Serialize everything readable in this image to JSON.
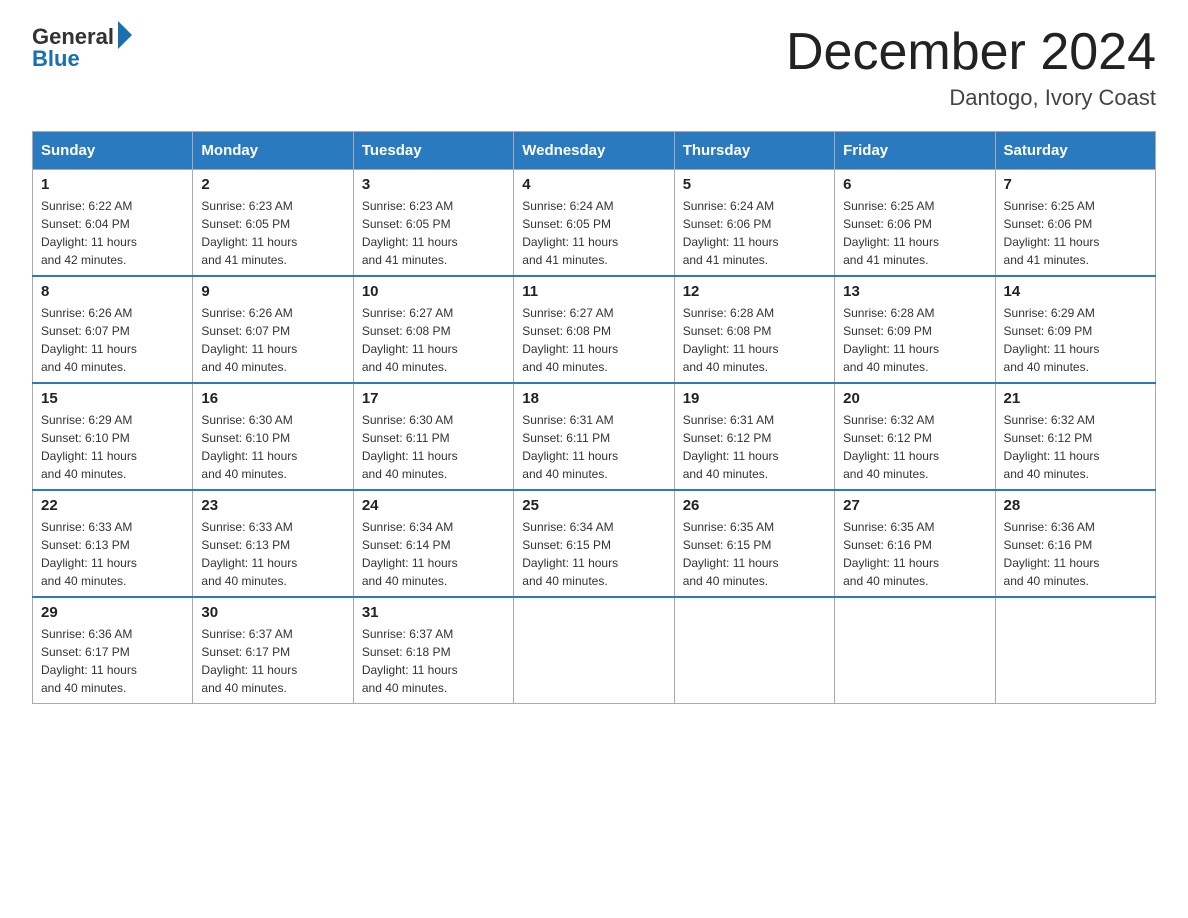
{
  "header": {
    "logo_general": "General",
    "logo_blue": "Blue",
    "title": "December 2024",
    "subtitle": "Dantogo, Ivory Coast"
  },
  "days_of_week": [
    "Sunday",
    "Monday",
    "Tuesday",
    "Wednesday",
    "Thursday",
    "Friday",
    "Saturday"
  ],
  "weeks": [
    [
      {
        "day": "1",
        "sunrise": "6:22 AM",
        "sunset": "6:04 PM",
        "daylight": "11 hours and 42 minutes."
      },
      {
        "day": "2",
        "sunrise": "6:23 AM",
        "sunset": "6:05 PM",
        "daylight": "11 hours and 41 minutes."
      },
      {
        "day": "3",
        "sunrise": "6:23 AM",
        "sunset": "6:05 PM",
        "daylight": "11 hours and 41 minutes."
      },
      {
        "day": "4",
        "sunrise": "6:24 AM",
        "sunset": "6:05 PM",
        "daylight": "11 hours and 41 minutes."
      },
      {
        "day": "5",
        "sunrise": "6:24 AM",
        "sunset": "6:06 PM",
        "daylight": "11 hours and 41 minutes."
      },
      {
        "day": "6",
        "sunrise": "6:25 AM",
        "sunset": "6:06 PM",
        "daylight": "11 hours and 41 minutes."
      },
      {
        "day": "7",
        "sunrise": "6:25 AM",
        "sunset": "6:06 PM",
        "daylight": "11 hours and 41 minutes."
      }
    ],
    [
      {
        "day": "8",
        "sunrise": "6:26 AM",
        "sunset": "6:07 PM",
        "daylight": "11 hours and 40 minutes."
      },
      {
        "day": "9",
        "sunrise": "6:26 AM",
        "sunset": "6:07 PM",
        "daylight": "11 hours and 40 minutes."
      },
      {
        "day": "10",
        "sunrise": "6:27 AM",
        "sunset": "6:08 PM",
        "daylight": "11 hours and 40 minutes."
      },
      {
        "day": "11",
        "sunrise": "6:27 AM",
        "sunset": "6:08 PM",
        "daylight": "11 hours and 40 minutes."
      },
      {
        "day": "12",
        "sunrise": "6:28 AM",
        "sunset": "6:08 PM",
        "daylight": "11 hours and 40 minutes."
      },
      {
        "day": "13",
        "sunrise": "6:28 AM",
        "sunset": "6:09 PM",
        "daylight": "11 hours and 40 minutes."
      },
      {
        "day": "14",
        "sunrise": "6:29 AM",
        "sunset": "6:09 PM",
        "daylight": "11 hours and 40 minutes."
      }
    ],
    [
      {
        "day": "15",
        "sunrise": "6:29 AM",
        "sunset": "6:10 PM",
        "daylight": "11 hours and 40 minutes."
      },
      {
        "day": "16",
        "sunrise": "6:30 AM",
        "sunset": "6:10 PM",
        "daylight": "11 hours and 40 minutes."
      },
      {
        "day": "17",
        "sunrise": "6:30 AM",
        "sunset": "6:11 PM",
        "daylight": "11 hours and 40 minutes."
      },
      {
        "day": "18",
        "sunrise": "6:31 AM",
        "sunset": "6:11 PM",
        "daylight": "11 hours and 40 minutes."
      },
      {
        "day": "19",
        "sunrise": "6:31 AM",
        "sunset": "6:12 PM",
        "daylight": "11 hours and 40 minutes."
      },
      {
        "day": "20",
        "sunrise": "6:32 AM",
        "sunset": "6:12 PM",
        "daylight": "11 hours and 40 minutes."
      },
      {
        "day": "21",
        "sunrise": "6:32 AM",
        "sunset": "6:12 PM",
        "daylight": "11 hours and 40 minutes."
      }
    ],
    [
      {
        "day": "22",
        "sunrise": "6:33 AM",
        "sunset": "6:13 PM",
        "daylight": "11 hours and 40 minutes."
      },
      {
        "day": "23",
        "sunrise": "6:33 AM",
        "sunset": "6:13 PM",
        "daylight": "11 hours and 40 minutes."
      },
      {
        "day": "24",
        "sunrise": "6:34 AM",
        "sunset": "6:14 PM",
        "daylight": "11 hours and 40 minutes."
      },
      {
        "day": "25",
        "sunrise": "6:34 AM",
        "sunset": "6:15 PM",
        "daylight": "11 hours and 40 minutes."
      },
      {
        "day": "26",
        "sunrise": "6:35 AM",
        "sunset": "6:15 PM",
        "daylight": "11 hours and 40 minutes."
      },
      {
        "day": "27",
        "sunrise": "6:35 AM",
        "sunset": "6:16 PM",
        "daylight": "11 hours and 40 minutes."
      },
      {
        "day": "28",
        "sunrise": "6:36 AM",
        "sunset": "6:16 PM",
        "daylight": "11 hours and 40 minutes."
      }
    ],
    [
      {
        "day": "29",
        "sunrise": "6:36 AM",
        "sunset": "6:17 PM",
        "daylight": "11 hours and 40 minutes."
      },
      {
        "day": "30",
        "sunrise": "6:37 AM",
        "sunset": "6:17 PM",
        "daylight": "11 hours and 40 minutes."
      },
      {
        "day": "31",
        "sunrise": "6:37 AM",
        "sunset": "6:18 PM",
        "daylight": "11 hours and 40 minutes."
      },
      null,
      null,
      null,
      null
    ]
  ],
  "labels": {
    "sunrise": "Sunrise:",
    "sunset": "Sunset:",
    "daylight": "Daylight:"
  }
}
